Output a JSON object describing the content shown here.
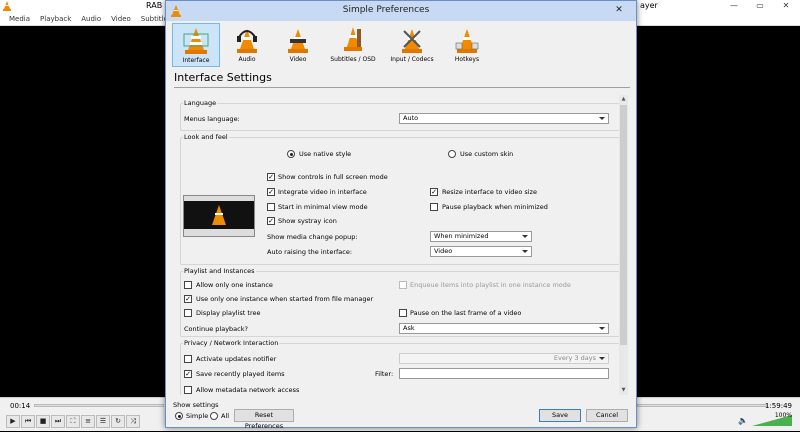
{
  "vlc": {
    "title_left": "RAB",
    "title_right": "ayer",
    "menu": [
      "Media",
      "Playback",
      "Audio",
      "Video",
      "Subtitle"
    ],
    "time_elapsed": "00:14",
    "time_total": "1:59:49",
    "volume": "100%"
  },
  "dialog": {
    "title": "Simple Preferences",
    "tabs": [
      {
        "label": "Interface"
      },
      {
        "label": "Audio"
      },
      {
        "label": "Video"
      },
      {
        "label": "Subtitles / OSD"
      },
      {
        "label": "Input / Codecs"
      },
      {
        "label": "Hotkeys"
      }
    ],
    "section_title": "Interface Settings",
    "language": {
      "group": "Language",
      "menus_language_label": "Menus language:",
      "menus_language_value": "Auto"
    },
    "look": {
      "group": "Look and feel",
      "native_style": "Use native style",
      "custom_skin": "Use custom skin",
      "fullscreen_controls": "Show controls in full screen mode",
      "integrate_video": "Integrate video in interface",
      "resize_interface": "Resize interface to video size",
      "minimal_view": "Start in minimal view mode",
      "pause_minimized": "Pause playback when minimized",
      "systray": "Show systray icon",
      "media_popup_label": "Show media change popup:",
      "media_popup_value": "When minimized",
      "auto_raise_label": "Auto raising the interface:",
      "auto_raise_value": "Video"
    },
    "playlist": {
      "group": "Playlist and Instances",
      "one_instance": "Allow only one instance",
      "enqueue": "Enqueue items into playlist in one instance mode",
      "one_instance_file": "Use only one instance when started from file manager",
      "playlist_tree": "Display playlist tree",
      "pause_last_frame": "Pause on the last frame of a video",
      "continue_label": "Continue playback?",
      "continue_value": "Ask"
    },
    "privacy": {
      "group": "Privacy / Network Interaction",
      "updates": "Activate updates notifier",
      "updates_value": "Every 3 days",
      "recent": "Save recently played items",
      "filter_label": "Filter:",
      "metadata": "Allow metadata network access"
    },
    "footer": {
      "show_settings": "Show settings",
      "simple": "Simple",
      "all": "All",
      "reset": "Reset Preferences",
      "save": "Save",
      "cancel": "Cancel"
    }
  }
}
